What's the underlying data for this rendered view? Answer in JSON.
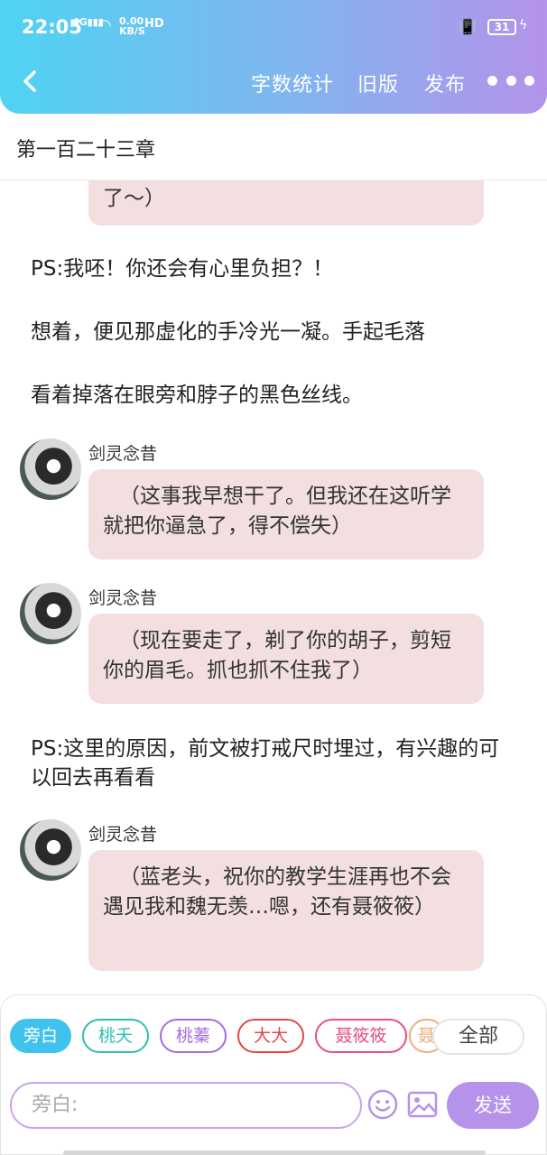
{
  "status": {
    "time": "22:05",
    "net": "4G",
    "speed_top": "0.00",
    "speed_bottom": "KB/S",
    "hd": "HD",
    "battery": "31"
  },
  "nav": {
    "word_count": "字数统计",
    "old_version": "旧版",
    "publish": "发布"
  },
  "chapter_title": "第一百二十三章",
  "messages": [
    {
      "type": "bubble",
      "text": "了〜）"
    },
    {
      "type": "narration",
      "text": "PS:我呸！你还会有心里负担？！"
    },
    {
      "type": "narration",
      "text": "想着，便见那虚化的手冷光一凝。手起毛落"
    },
    {
      "type": "narration",
      "text": "看着掉落在眼旁和脖子的黑色丝线。"
    },
    {
      "type": "character",
      "name": "剑灵念昔",
      "text": "（这事我早想干了。但我还在这听学就把你逼急了，得不偿失）"
    },
    {
      "type": "character",
      "name": "剑灵念昔",
      "text": "（现在要走了，剃了你的胡子，剪短你的眉毛。抓也抓不住我了）"
    },
    {
      "type": "narration",
      "text": "PS:这里的原因，前文被打戒尺时埋过，有兴趣的可以回去再看看"
    },
    {
      "type": "character",
      "name": "剑灵念昔",
      "text": "（蓝老头，祝你的教学生涯再也不会遇见我和魏无羡…嗯，还有聂筱筱）"
    }
  ],
  "role_chips": [
    {
      "label": "旁白",
      "color": "#3fc3ee",
      "selected": true
    },
    {
      "label": "桃夭",
      "color": "#2fbfb0",
      "selected": false
    },
    {
      "label": "桃蓁",
      "color": "#a56be0",
      "selected": false
    },
    {
      "label": "大大",
      "color": "#e04848",
      "selected": false
    },
    {
      "label": "聂筱筱",
      "color": "#e5507f",
      "selected": false
    },
    {
      "label": "聂",
      "color": "#e8b07a",
      "selected": false
    }
  ],
  "all_label": "全部",
  "input": {
    "placeholder": "旁白:"
  },
  "send_label": "发送"
}
